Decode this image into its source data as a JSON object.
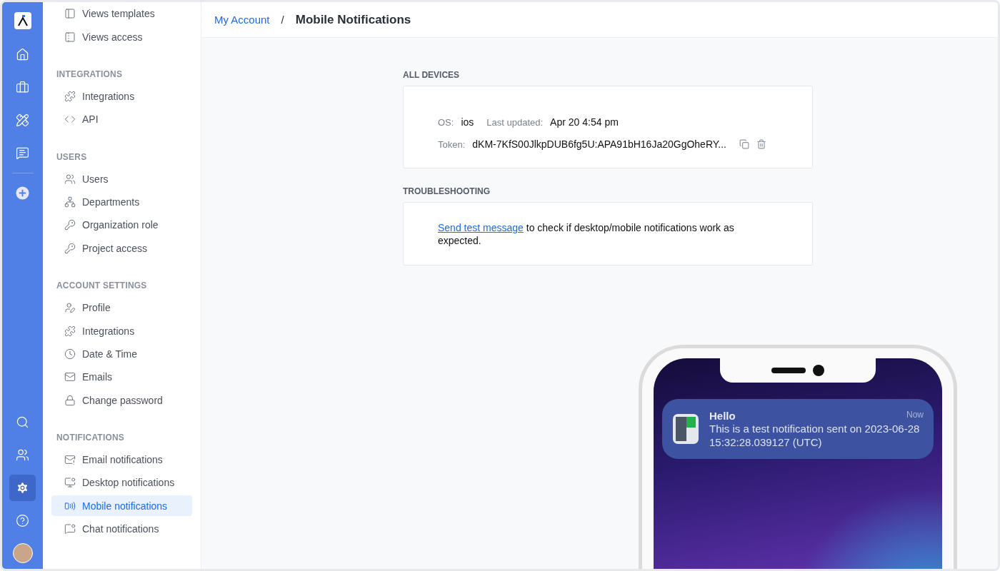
{
  "rail": {
    "top": [
      {
        "selected": false
      },
      {
        "selected": false
      },
      {
        "selected": false
      },
      {
        "selected": false
      }
    ],
    "bottom": [
      {
        "selected": false
      },
      {
        "selected": false
      },
      {
        "selected": true
      },
      {
        "selected": false
      }
    ]
  },
  "sidebar": {
    "items_top": [
      {
        "label": "Views templates",
        "selected": false
      },
      {
        "label": "Views access",
        "selected": false
      }
    ],
    "sections": [
      {
        "title": "INTEGRATIONS",
        "items": [
          {
            "label": "Integrations",
            "selected": false
          },
          {
            "label": "API",
            "selected": false
          }
        ]
      },
      {
        "title": "USERS",
        "items": [
          {
            "label": "Users",
            "selected": false
          },
          {
            "label": "Departments",
            "selected": false
          },
          {
            "label": "Organization role",
            "selected": false
          },
          {
            "label": "Project access",
            "selected": false
          }
        ]
      },
      {
        "title": "ACCOUNT SETTINGS",
        "items": [
          {
            "label": "Profile",
            "selected": false
          },
          {
            "label": "Integrations",
            "selected": false
          },
          {
            "label": "Date & Time",
            "selected": false
          },
          {
            "label": "Emails",
            "selected": false
          },
          {
            "label": "Change password",
            "selected": false
          }
        ]
      },
      {
        "title": "NOTIFICATIONS",
        "items": [
          {
            "label": "Email notifications",
            "selected": false
          },
          {
            "label": "Desktop notifications",
            "selected": false
          },
          {
            "label": "Mobile notifications",
            "selected": true
          },
          {
            "label": "Chat notifications",
            "selected": false
          }
        ]
      }
    ]
  },
  "breadcrumb": {
    "link": "My Account",
    "separator": "/",
    "current": "Mobile Notifications"
  },
  "devices": {
    "title": "ALL DEVICES",
    "os_label": "OS:",
    "os": "ios",
    "updated_label": "Last updated:",
    "updated": "Apr 20 4:54 pm",
    "token_label": "Token:",
    "token": "dKM-7KfS00JlkpDUB6fg5U:APA91bH16Ja20GgOheRY..."
  },
  "troubleshooting": {
    "title": "TROUBLESHOOTING",
    "link": "Send test message",
    "text": " to check if desktop/mobile notifications work as expected."
  },
  "phone": {
    "notification": {
      "title": "Hello",
      "time": "Now",
      "body": "This is a test notification sent on 2023-06-28 15:32:28.039127 (UTC)"
    }
  }
}
